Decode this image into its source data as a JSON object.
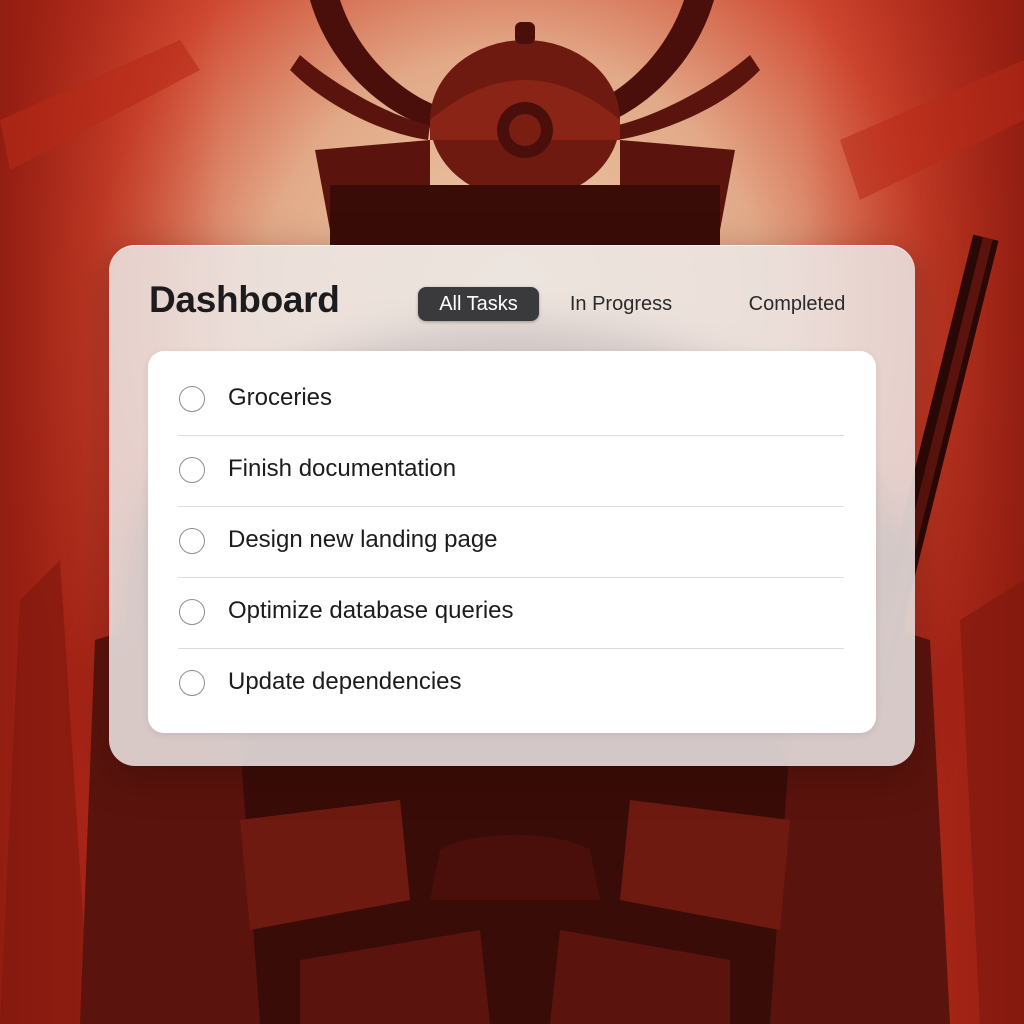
{
  "header": {
    "title": "Dashboard"
  },
  "tabs": [
    {
      "label": "All Tasks",
      "active": true
    },
    {
      "label": "In Progress",
      "active": false
    },
    {
      "label": "Completed",
      "active": false
    }
  ],
  "tasks": [
    {
      "label": "Groceries",
      "done": false
    },
    {
      "label": "Finish documentation",
      "done": false
    },
    {
      "label": "Design new landing page",
      "done": false
    },
    {
      "label": "Optimize database queries",
      "done": false
    },
    {
      "label": "Update dependencies",
      "done": false
    }
  ],
  "colors": {
    "background_red": "#c8301c",
    "background_cream": "#e9c9a6",
    "figure_dark": "#3a0c08",
    "active_tab": "#3a3a3c",
    "text_primary": "#1c1c1e",
    "checkbox_border": "#8e8e93"
  },
  "icons": {
    "task_checkbox": "empty-circle-icon"
  },
  "background": {
    "description_icon": "samurai-illustration"
  }
}
